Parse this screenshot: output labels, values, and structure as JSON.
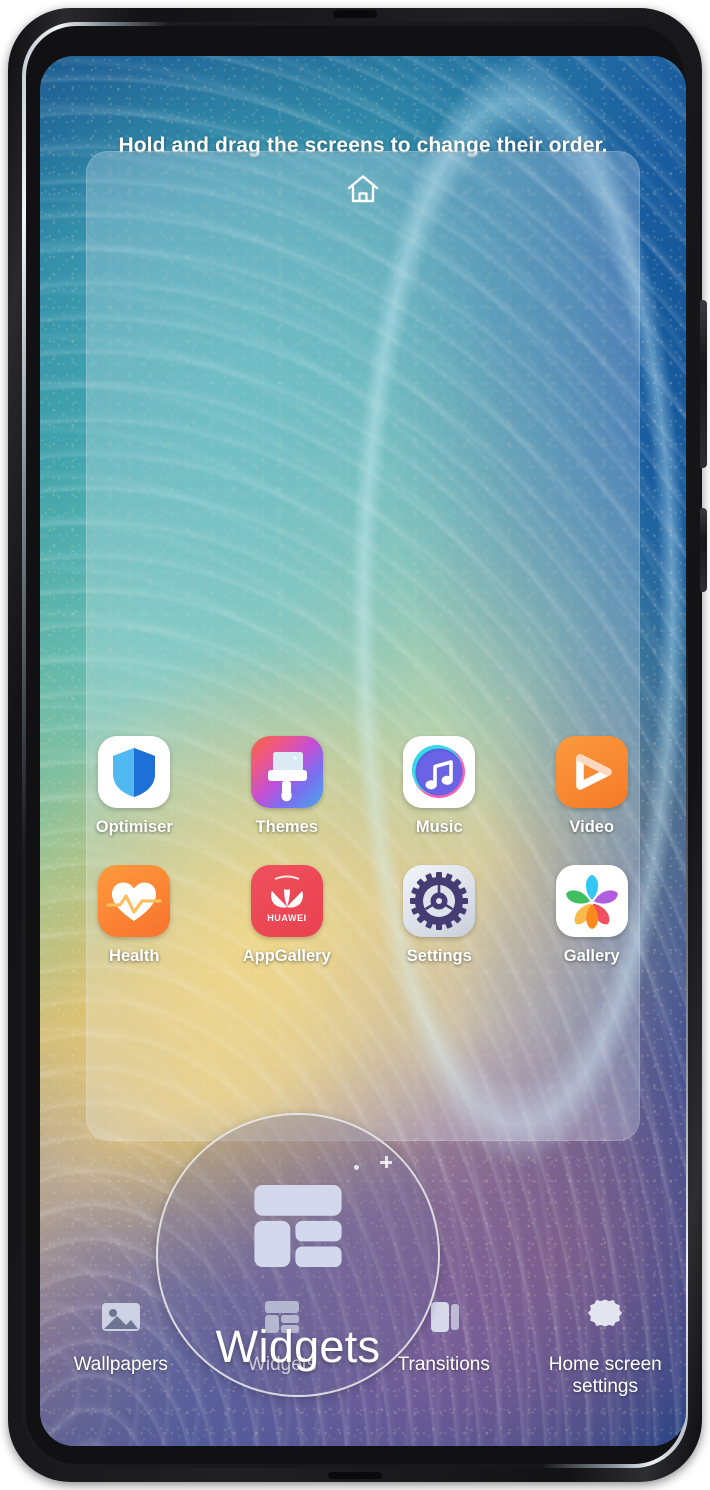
{
  "device": {
    "name": "huawei-smartphone",
    "frame_color": "#1b1b1e",
    "rim_color": "#c5ced8"
  },
  "screen": {
    "hint": "Hold and drag the screens to change their order.",
    "home_icon": "home-icon"
  },
  "preview_card": {
    "label": "home-screen-preview"
  },
  "apps": [
    {
      "label": "Optimiser",
      "icon": "optimiser-shield-icon"
    },
    {
      "label": "Themes",
      "icon": "themes-brush-icon"
    },
    {
      "label": "Music",
      "icon": "music-note-icon"
    },
    {
      "label": "Video",
      "icon": "video-play-icon"
    },
    {
      "label": "Health",
      "icon": "health-heart-icon"
    },
    {
      "label": "AppGallery",
      "icon": "appgallery-huawei-icon"
    },
    {
      "label": "Settings",
      "icon": "settings-gear-icon"
    },
    {
      "label": "Gallery",
      "icon": "gallery-flower-icon"
    }
  ],
  "toolbar": [
    {
      "label": "Wallpapers",
      "icon": "wallpaper-image-icon"
    },
    {
      "label": "Widgets",
      "icon": "widgets-grid-icon"
    },
    {
      "label": "Transitions",
      "icon": "transitions-cards-icon"
    },
    {
      "label": "Home screen\nsettings",
      "icon": "home-settings-gear-icon"
    }
  ],
  "magnifier": {
    "target": "Widgets",
    "icon": "widgets-grid-icon",
    "border_color": "#ebebeb"
  },
  "colors": {
    "hint_text": "#ffffff",
    "label_text": "#ffffff",
    "card_fill": "rgba(236,244,250,0.26)",
    "video_orange": "#f57a28",
    "health_orange": "#f8722e",
    "appgallery_red": "#e8414f",
    "optimiser_blue": "#2f8ae0",
    "settings_purple": "#4a3f77"
  }
}
